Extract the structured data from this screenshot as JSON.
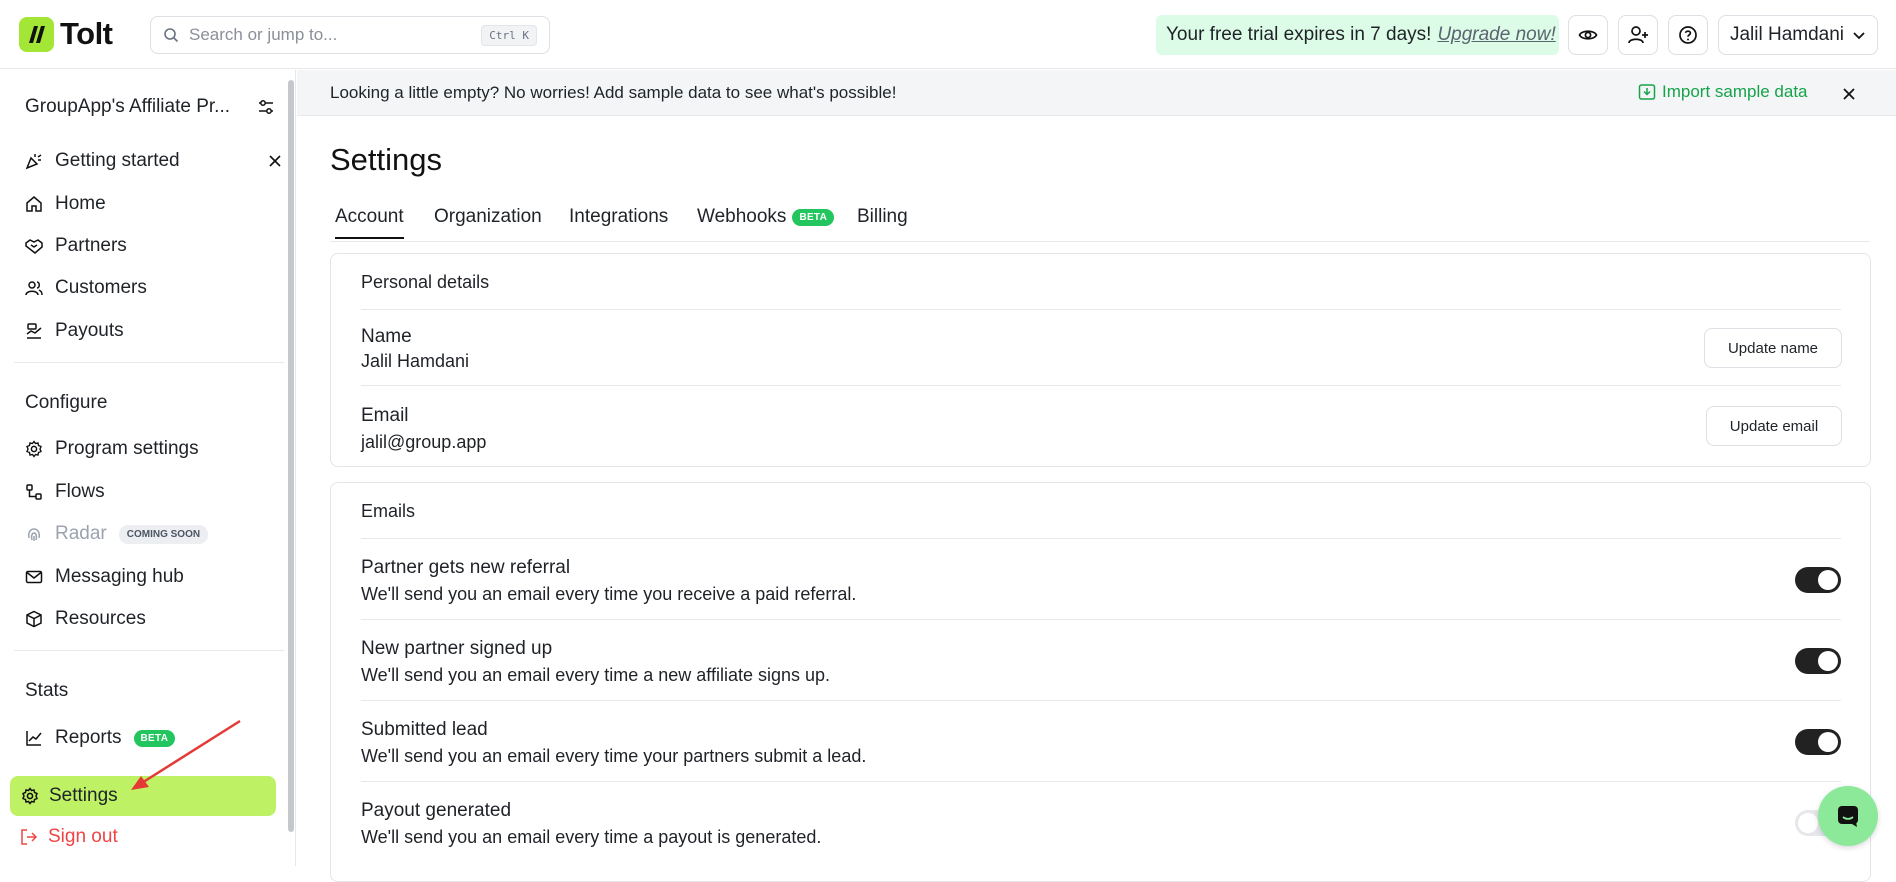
{
  "app": {
    "logo_text": "Tolt"
  },
  "search": {
    "placeholder": "Search or jump to...",
    "shortcut": "Ctrl K"
  },
  "trial": {
    "text": "Your free trial expires in 7 days!",
    "upgrade": "Upgrade now!"
  },
  "user": {
    "name": "Jalil Hamdani"
  },
  "sidebar": {
    "org_name": "GroupApp's Affiliate Pr...",
    "main_items": [
      {
        "label": "Getting started",
        "icon": "party-popper-icon"
      },
      {
        "label": "Home",
        "icon": "home-icon"
      },
      {
        "label": "Partners",
        "icon": "handshake-icon"
      },
      {
        "label": "Customers",
        "icon": "users-icon"
      },
      {
        "label": "Payouts",
        "icon": "payout-icon"
      }
    ],
    "configure_title": "Configure",
    "configure_items": [
      {
        "label": "Program settings",
        "icon": "gear-icon"
      },
      {
        "label": "Flows",
        "icon": "flow-icon"
      },
      {
        "label": "Radar",
        "icon": "fingerprint-icon",
        "badge": "COMING SOON"
      },
      {
        "label": "Messaging hub",
        "icon": "mail-icon"
      },
      {
        "label": "Resources",
        "icon": "package-icon"
      }
    ],
    "stats_title": "Stats",
    "stats_items": [
      {
        "label": "Reports",
        "icon": "chart-icon",
        "badge": "BETA"
      }
    ],
    "settings_label": "Settings",
    "signout_label": "Sign out"
  },
  "banner": {
    "text": "Looking a little empty? No worries! Add sample data to see what's possible!",
    "import_label": "Import sample data"
  },
  "page": {
    "title": "Settings"
  },
  "tabs": [
    {
      "label": "Account",
      "active": true
    },
    {
      "label": "Organization"
    },
    {
      "label": "Integrations"
    },
    {
      "label": "Webhooks",
      "badge": "BETA"
    },
    {
      "label": "Billing"
    }
  ],
  "personal": {
    "title": "Personal details",
    "name_label": "Name",
    "name_value": "Jalil Hamdani",
    "update_name": "Update name",
    "email_label": "Email",
    "email_value": "jalil@group.app",
    "update_email": "Update email"
  },
  "emails": {
    "title": "Emails",
    "items": [
      {
        "title": "Partner gets new referral",
        "desc": "We'll send you an email every time you receive a paid referral.",
        "enabled": true
      },
      {
        "title": "New partner signed up",
        "desc": "We'll send you an email every time a new affiliate signs up.",
        "enabled": true
      },
      {
        "title": "Submitted lead",
        "desc": "We'll send you an email every time your partners submit a lead.",
        "enabled": true
      },
      {
        "title": "Payout generated",
        "desc": "We'll send you an email every time a payout is generated.",
        "enabled": false
      }
    ]
  },
  "colors": {
    "accent": "#bef264",
    "brand": "#a3e635",
    "trial_bg": "#dcfce7",
    "beta": "#22c55e",
    "signout": "#ef4444"
  }
}
